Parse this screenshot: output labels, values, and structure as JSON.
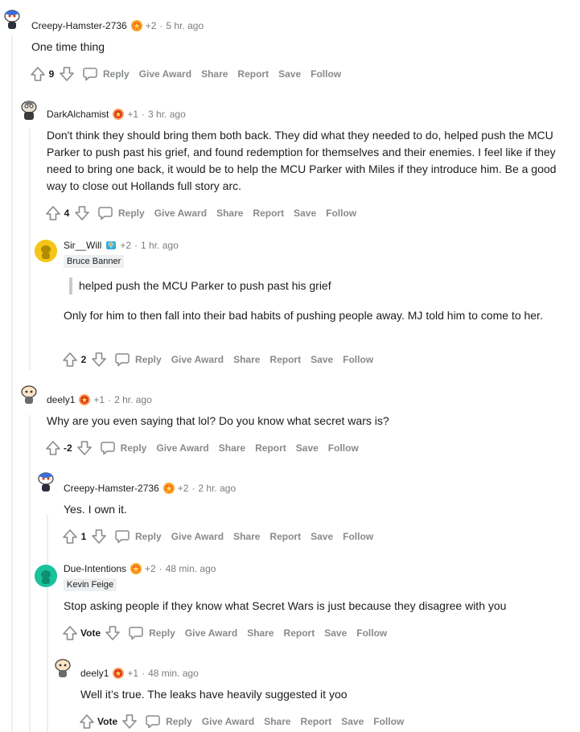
{
  "comments": [
    {
      "username": "Creepy-Hamster-2736",
      "plus": "+2",
      "time": "5 hr. ago",
      "flair": "",
      "body": "One time thing",
      "quote": "",
      "score": "9"
    },
    {
      "username": "DarkAlchamist",
      "plus": "+1",
      "time": "3 hr. ago",
      "flair": "",
      "body": "Don't think they should bring them both back. They did what they needed to do, helped push the MCU Parker to push past his grief, and found redemption for themselves and their enemies. I feel like if they need to bring one back, it would be to help the MCU Parker with Miles if they introduce him. Be a good way to close out Hollands full story arc.",
      "quote": "",
      "score": "4"
    },
    {
      "username": "Sir__Will",
      "plus": "+2",
      "time": "1 hr. ago",
      "flair": "Bruce Banner",
      "quote": "helped push the MCU Parker to push past his grief",
      "body": "Only for him to then fall into their bad habits of pushing people away. MJ told him to come to her.",
      "score": "2"
    },
    {
      "username": "deely1",
      "plus": "+1",
      "time": "2 hr. ago",
      "flair": "",
      "body": "Why are you even saying that lol? Do you know what secret wars is?",
      "quote": "",
      "score": "-2"
    },
    {
      "username": "Creepy-Hamster-2736",
      "plus": "+2",
      "time": "2 hr. ago",
      "flair": "",
      "body": "Yes. I own it.",
      "quote": "",
      "score": "1"
    },
    {
      "username": "Due-Intentions",
      "plus": "+2",
      "time": "48 min. ago",
      "flair": "Kevin Feige",
      "body": "Stop asking people if they know what Secret Wars is just because they disagree with you",
      "quote": "",
      "score": "Vote"
    },
    {
      "username": "deely1",
      "plus": "+1",
      "time": "48 min. ago",
      "flair": "",
      "body": "Well it’s true. The leaks have heavily suggested it yoo",
      "quote": "",
      "score": "Vote"
    }
  ],
  "actions": {
    "reply": "Reply",
    "give_award": "Give Award",
    "share": "Share",
    "report": "Report",
    "save": "Save",
    "follow": "Follow"
  },
  "separator": "·",
  "colors": {
    "text": "#1c1c1c",
    "meta": "#7c7c7c",
    "action": "#878a8c",
    "thread": "#edeff1",
    "flair_bg": "#edeff1",
    "quote_bar": "#c8cbcd"
  },
  "icons": [
    "upvote-icon",
    "downvote-icon",
    "reply-icon",
    "award-icon",
    "snoo-avatar",
    "blank-avatar"
  ]
}
